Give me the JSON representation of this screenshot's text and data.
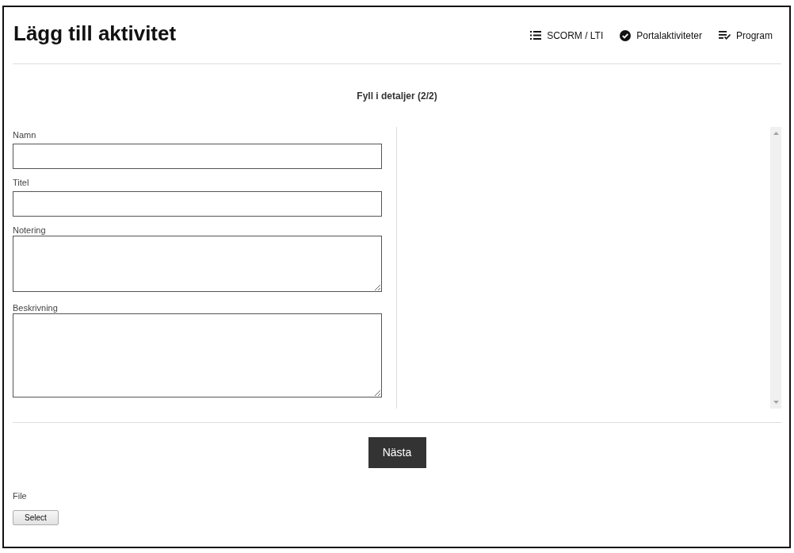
{
  "header": {
    "title": "Lägg till aktivitet",
    "links": [
      {
        "kind": "list",
        "label": "SCORM / LTI"
      },
      {
        "kind": "check",
        "label": "Portalaktiviteter"
      },
      {
        "kind": "checklist",
        "label": "Program"
      }
    ]
  },
  "step_title": "Fyll i detaljer (2/2)",
  "form": {
    "fields": [
      {
        "kind": "input",
        "label": "Namn"
      },
      {
        "kind": "input",
        "label": "Titel"
      },
      {
        "kind": "textarea",
        "label": "Notering"
      },
      {
        "kind": "textarea",
        "label": "Beskrivning"
      }
    ]
  },
  "next_button": "Nästa",
  "file": {
    "label": "File",
    "button": "Select"
  }
}
